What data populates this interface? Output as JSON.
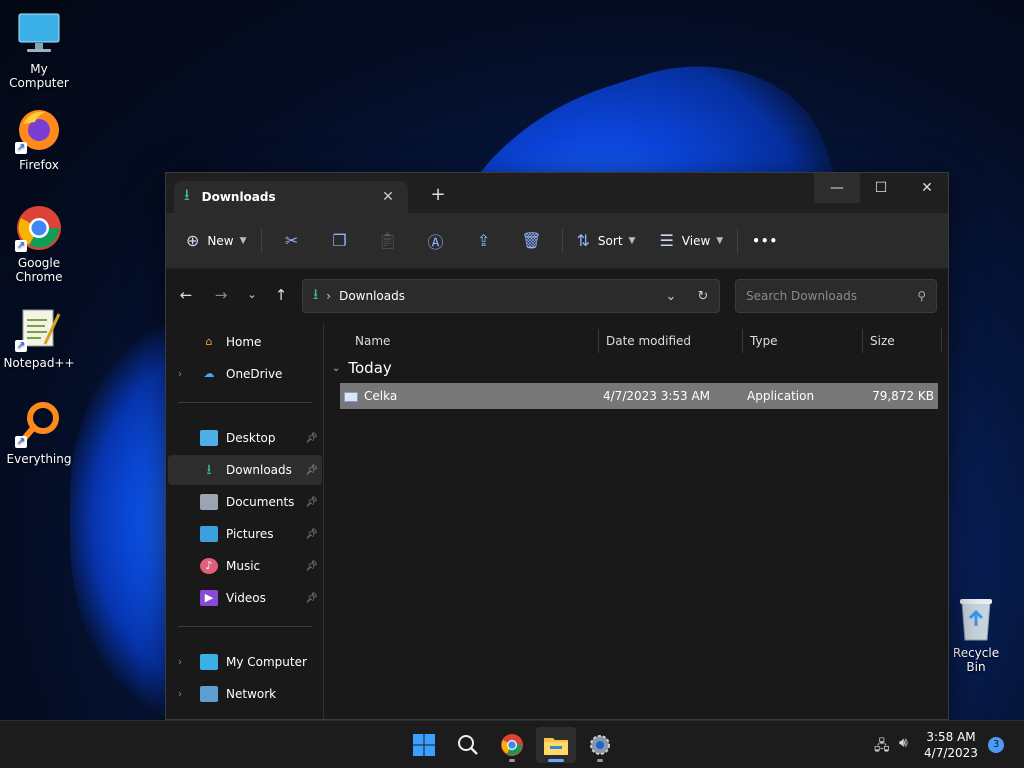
{
  "desktop": {
    "icons": [
      {
        "label": "My Computer"
      },
      {
        "label": "Firefox"
      },
      {
        "label": "Google Chrome"
      },
      {
        "label": "Notepad++"
      },
      {
        "label": "Everything"
      }
    ],
    "recycle_bin": "Recycle Bin"
  },
  "window": {
    "tab_title": "Downloads",
    "toolbar": {
      "new_label": "New",
      "sort_label": "Sort",
      "view_label": "View",
      "more_label": "•••"
    },
    "address": {
      "path": "Downloads",
      "search_placeholder": "Search Downloads"
    },
    "nav": {
      "items": [
        {
          "label": "Home"
        },
        {
          "label": "OneDrive"
        },
        {
          "label": "Desktop"
        },
        {
          "label": "Downloads"
        },
        {
          "label": "Documents"
        },
        {
          "label": "Pictures"
        },
        {
          "label": "Music"
        },
        {
          "label": "Videos"
        },
        {
          "label": "My Computer"
        },
        {
          "label": "Network"
        }
      ]
    },
    "columns": {
      "name": "Name",
      "date": "Date modified",
      "type": "Type",
      "size": "Size"
    },
    "group_label": "Today",
    "files": [
      {
        "name": "Celka",
        "date": "4/7/2023 3:53 AM",
        "type": "Application",
        "size": "79,872 KB"
      }
    ]
  },
  "taskbar": {
    "time": "3:58 AM",
    "date": "4/7/2023",
    "notification_count": "3"
  },
  "colors": {
    "accent": "#4c9cf5",
    "selection": "#777777",
    "window_bg": "#191919"
  }
}
